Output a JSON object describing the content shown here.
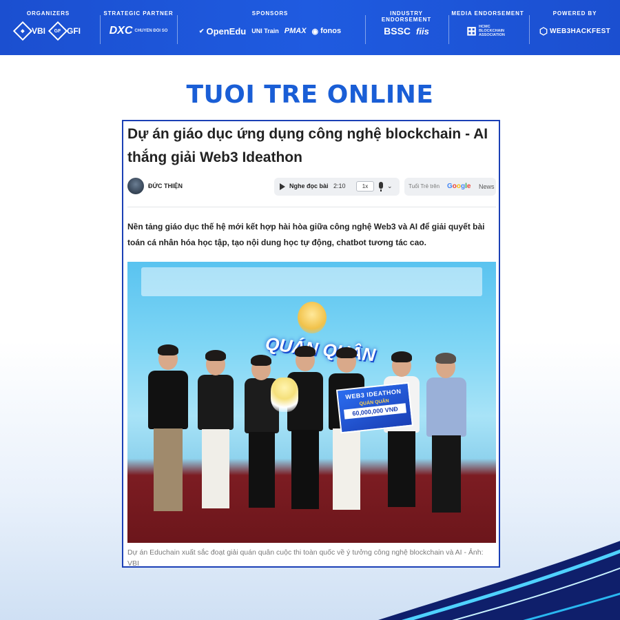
{
  "banner": {
    "organizers": {
      "label": "ORGANIZERS",
      "logos": [
        "VBI",
        "GFI"
      ]
    },
    "strategic_partner": {
      "label": "STRATEGIC PARTNER",
      "logos": [
        "DXC",
        "CHUYỂN ĐỔI SỐ"
      ]
    },
    "sponsors": {
      "label": "SPONSORS",
      "logos": [
        "OpenEdu",
        "UNI Train",
        "PMAX",
        "fonos"
      ]
    },
    "industry_endorsement": {
      "label": "INDUSTRY ENDORSEMENT",
      "logos": [
        "BSSC",
        "fiis"
      ]
    },
    "media_endorsement": {
      "label": "MEDIA ENDORSEMENT",
      "logos": [
        "HCMC BLOCKCHAIN ASSOCIATION"
      ]
    },
    "powered_by": {
      "label": "POWERED BY",
      "logos": [
        "WEB3HACKFEST"
      ]
    }
  },
  "page": {
    "brand_title": "TUOI TRE ONLINE"
  },
  "article": {
    "headline": "Dự án giáo dục ứng dụng công nghệ blockchain - AI thắng giải Web3 Ideathon",
    "author": "ĐỨC THIỆN",
    "player": {
      "label": "Nghe đọc bài",
      "duration": "2:10",
      "speed": "1x"
    },
    "gnews": {
      "prefix": "Tuổi Trẻ trên",
      "google": "Google",
      "news": "News"
    },
    "lead": "Nền tảng giáo dục thế hệ mới kết hợp hài hòa giữa công nghệ Web3 và AI để giải quyết bài toán cá nhân hóa học tập, tạo nội dung học tự động, chatbot tương tác cao.",
    "photo": {
      "banner_word": "QUÁN QUÂN",
      "prize_title": "WEB3 IDEATHON",
      "prize_sub": "QUÁN QUÂN",
      "prize_amount": "60,000,000 VNĐ"
    },
    "caption": "Dự án Educhain xuất sắc đoạt giải quán quân cuộc thi toàn quốc về ý tưởng công nghệ blockchain và AI - Ảnh: VBI"
  },
  "colors": {
    "banner_bg": "#1f5be0",
    "brand_title": "#1a5ed6",
    "card_border": "#1a3fb5"
  }
}
